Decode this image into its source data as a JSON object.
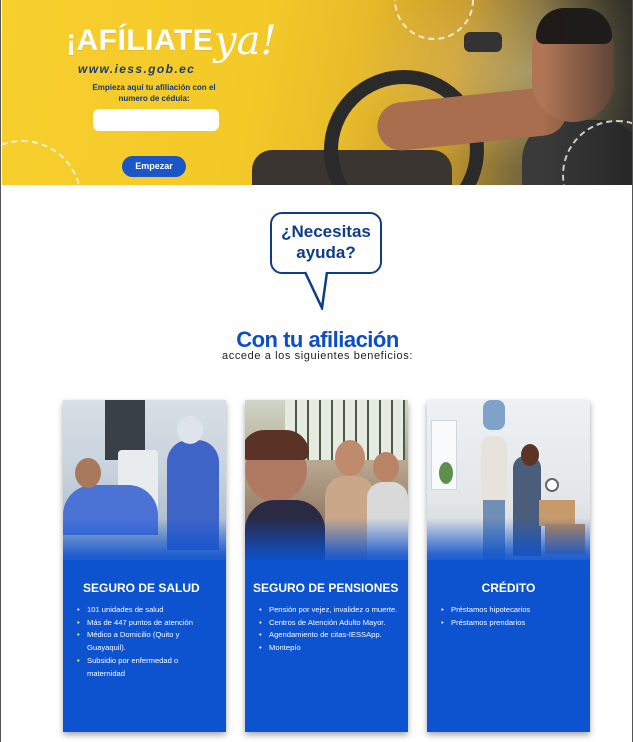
{
  "hero": {
    "headline": "¡AFÍLIATE",
    "headline_script": "ya!",
    "url": "www.iess.gob.ec",
    "prompt": "Empieza aquí tu afiliación con el numero de cédula:",
    "cedula_value": "",
    "cta_label": "Empezar",
    "accent_color": "#f5cd2c",
    "button_color": "#1b56c8"
  },
  "help": {
    "bubble_text": "¿Necesitas ayuda?"
  },
  "benefits": {
    "title": "Con tu afiliación",
    "subtitle": "accede a los siguientes beneficios:",
    "cards": [
      {
        "title": "SEGURO DE SALUD",
        "items": [
          "101 unidades de salud",
          "Más de 447 puntos de atención",
          "Médico a Domicilio (Quito y Guayaquil).",
          "Subsidio por enfermedad o maternidad"
        ]
      },
      {
        "title": "SEGURO DE PENSIONES",
        "items": [
          "Pensión por vejez, invalidez o muerte.",
          "Centros de Atención Adulto Mayor.",
          "Agendamiento de citas-IESSApp.",
          "Montepío"
        ]
      },
      {
        "title": "CRÉDITO",
        "items": [
          "Préstamos hipotecarios",
          "Préstamos prendarios"
        ]
      }
    ],
    "card_color": "#0d52cf"
  }
}
